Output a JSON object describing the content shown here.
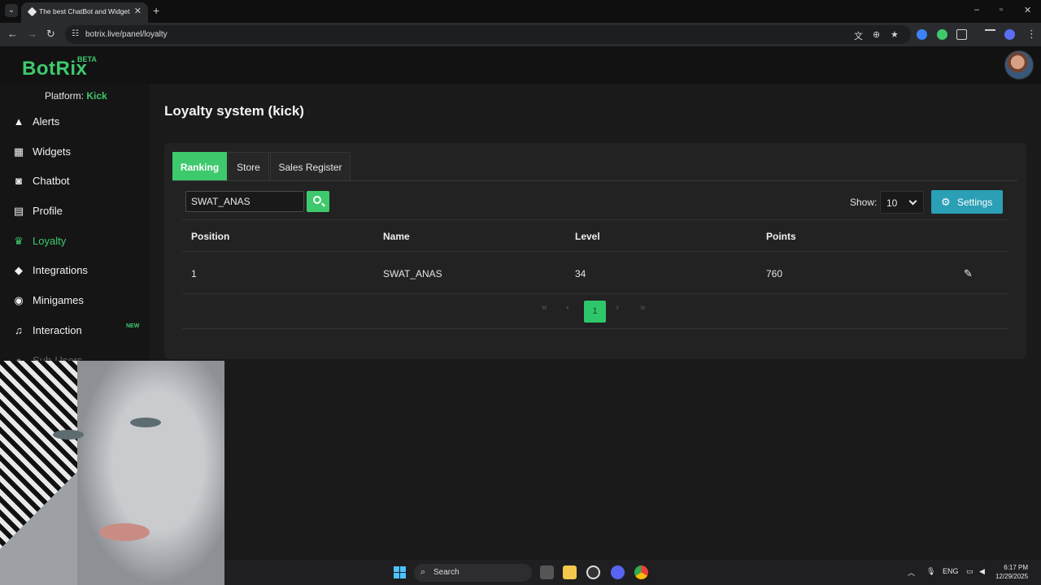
{
  "browser": {
    "tab_title": "The best ChatBot and Widgets",
    "url": "botrix.live/panel/loyalty"
  },
  "app": {
    "logo": "BotRix",
    "logo_badge": "BETA",
    "platform_label": "Platform:",
    "platform_value": "Kick",
    "accent_color": "#3ec96d",
    "settings_color": "#2b9fb5"
  },
  "sidebar": {
    "items": [
      {
        "label": "Alerts",
        "icon": "warning-icon"
      },
      {
        "label": "Widgets",
        "icon": "grid-icon"
      },
      {
        "label": "Chatbot",
        "icon": "robot-icon"
      },
      {
        "label": "Profile",
        "icon": "id-card-icon"
      },
      {
        "label": "Loyalty",
        "icon": "trophy-icon",
        "active": true
      },
      {
        "label": "Integrations",
        "icon": "cube-icon"
      },
      {
        "label": "Minigames",
        "icon": "gamepad-icon"
      },
      {
        "label": "Interaction",
        "icon": "music-icon",
        "badge": "NEW"
      },
      {
        "label": "Sub-Users",
        "icon": "users-icon"
      }
    ]
  },
  "main": {
    "title": "Loyalty system (kick)",
    "tabs": [
      "Ranking",
      "Store",
      "Sales Register"
    ],
    "search_value": "SWAT_ANAS",
    "show_label": "Show:",
    "show_value": "10",
    "settings_label": "Settings",
    "table": {
      "headers": [
        "Position",
        "Name",
        "Level",
        "Points"
      ],
      "rows": [
        {
          "position": "1",
          "name": "SWAT_ANAS",
          "level": "34",
          "points": "760"
        }
      ]
    },
    "pagination": {
      "first": "«",
      "prev": "‹",
      "current": "1",
      "next": "›",
      "last": "»"
    }
  },
  "taskbar": {
    "search_label": "Search",
    "language": "ENG",
    "time": "6:17 PM",
    "date": "12/29/2025"
  }
}
